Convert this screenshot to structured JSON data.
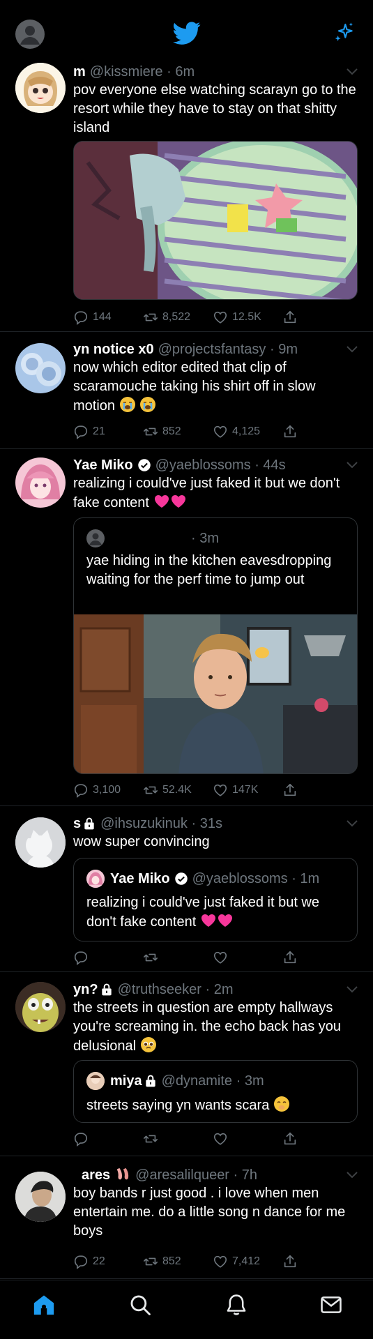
{
  "colors": {
    "background": "#000000",
    "accent": "#1d9bf0",
    "muted": "#6e767d",
    "divider": "#1f2327",
    "heart": "#f91880"
  },
  "header": {
    "logo_icon": "twitter-bird-icon",
    "sparkle_icon": "sparkle-icon"
  },
  "tweets": [
    {
      "name": "m",
      "handle": "@kissmiere",
      "time": "· 6m",
      "text": "pov everyone else watching scarayn go to the resort while they have to stay on that shitty island",
      "media": "squidward-window-image",
      "stats": {
        "replies": "144",
        "retweets": "8,522",
        "likes": "12.5K"
      }
    },
    {
      "name": "yn notice x0",
      "handle": "@projectsfantasy",
      "time": "· 9m",
      "text": "now which editor edited that clip of scaramouche taking his shirt off in slow motion",
      "stats": {
        "replies": "21",
        "retweets": "852",
        "likes": "4,125"
      }
    },
    {
      "name": "Yae Miko",
      "handle": "@yaeblossoms",
      "time": "· 44s",
      "text": "realizing i could've just faked it but we don't fake content",
      "quote": {
        "name": "",
        "handle": "",
        "time": "· 3m",
        "text": "yae hiding in the kitchen eavesdropping waiting for the perf time to jump out",
        "media": "kitchen-boy-image"
      },
      "stats": {
        "replies": "3,100",
        "retweets": "52.4K",
        "likes": "147K"
      }
    },
    {
      "name": "s",
      "handle": "@ihsuzukinuk",
      "time": "· 31s",
      "text": "wow super convincing",
      "quote": {
        "name": "Yae Miko",
        "handle": "@yaeblossoms",
        "time": "· 1m",
        "text": "realizing i could've just faked it but we don't fake content"
      },
      "stats": {
        "replies": "",
        "retweets": "",
        "likes": ""
      }
    },
    {
      "name": "yn?",
      "handle": "@truthseeker",
      "time": "· 2m",
      "text": "the streets in question are empty hallways you're screaming in. the echo back has you delusional",
      "quote": {
        "name": "miya",
        "handle": "@dynamite",
        "time": "· 3m",
        "text": "streets saying yn wants scara"
      },
      "stats": {
        "replies": "",
        "retweets": "",
        "likes": ""
      }
    },
    {
      "name": "ares",
      "handle": "@aresalilqueer",
      "time": "· 7h",
      "text": "boy bands r just good . i love when men entertain me. do a little song n dance for me boys",
      "stats": {
        "replies": "22",
        "retweets": "852",
        "likes": "7,412"
      }
    }
  ],
  "tabbar": [
    "home-icon",
    "search-icon",
    "notifications-icon",
    "messages-icon"
  ]
}
